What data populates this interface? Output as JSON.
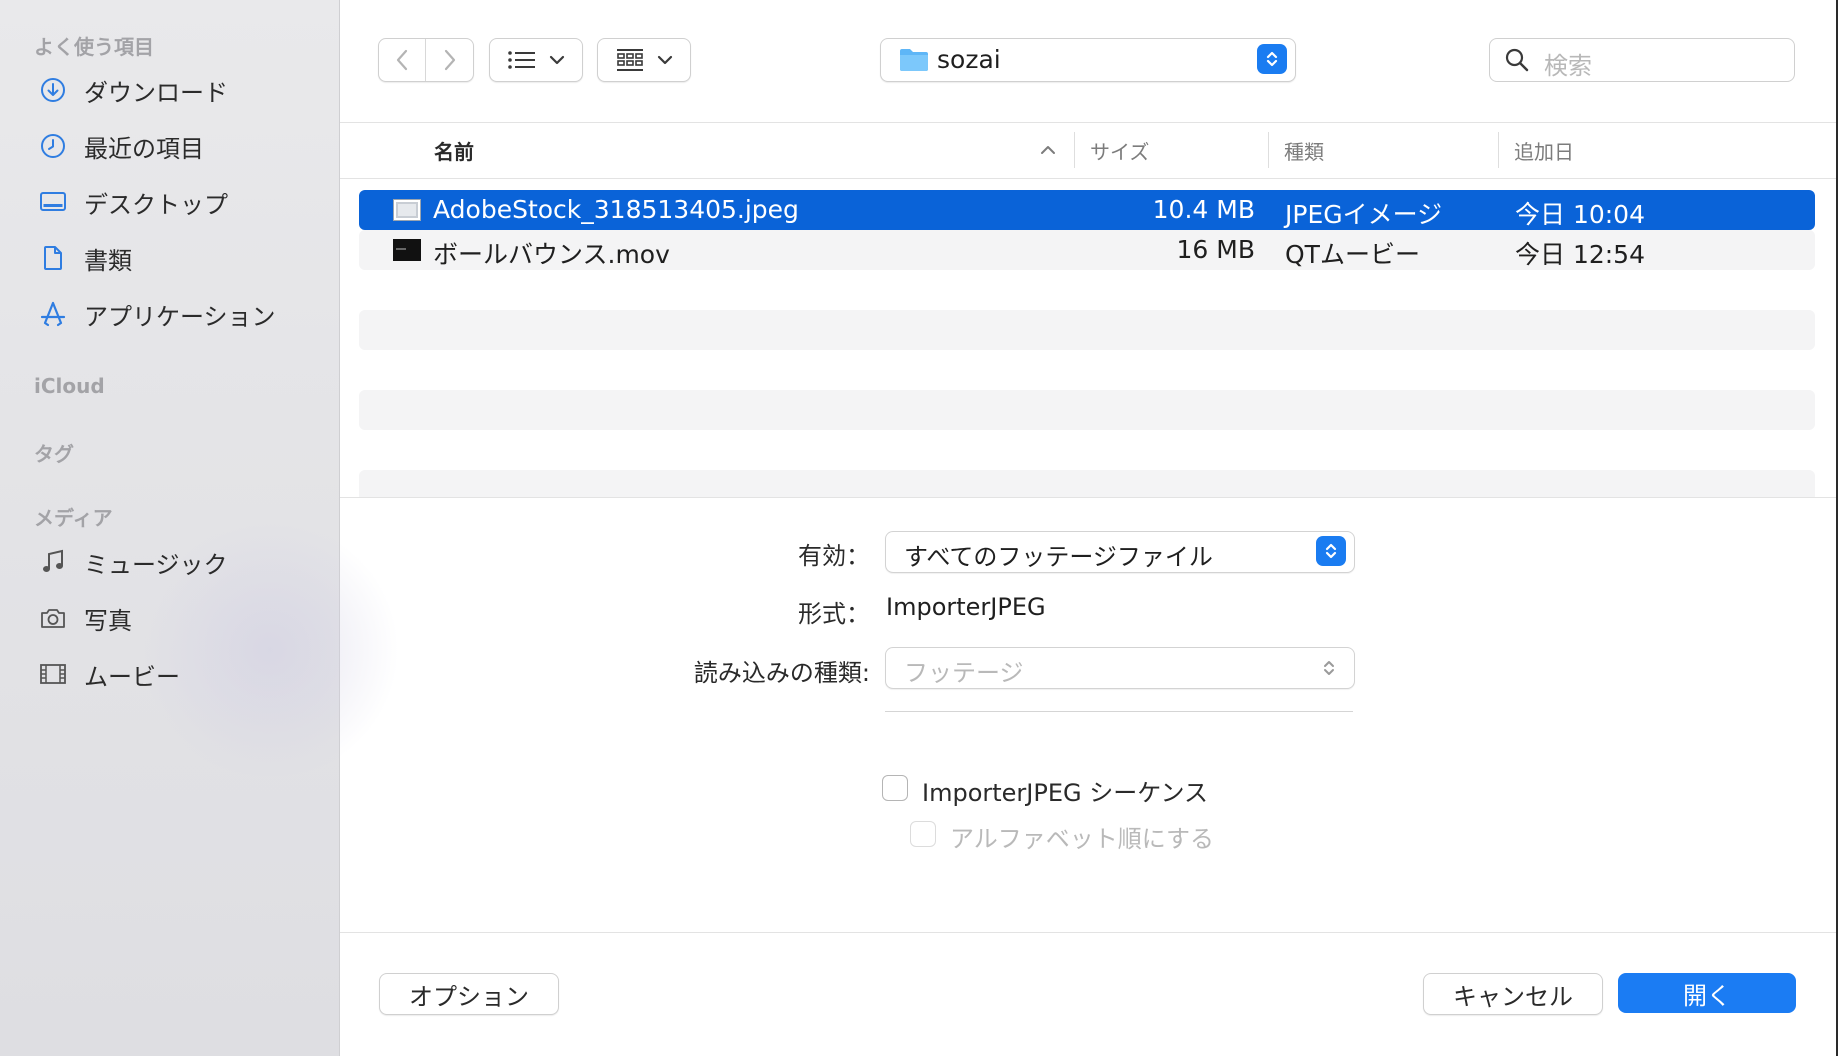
{
  "sidebar": {
    "favorites_header": "よく使う項目",
    "favorites": [
      {
        "label": "ダウンロード",
        "icon": "download-icon"
      },
      {
        "label": "最近の項目",
        "icon": "clock-icon"
      },
      {
        "label": "デスクトップ",
        "icon": "desktop-icon"
      },
      {
        "label": "書類",
        "icon": "document-icon"
      },
      {
        "label": "アプリケーション",
        "icon": "applications-icon"
      }
    ],
    "icloud_header": "iCloud",
    "tags_header": "タグ",
    "media_header": "メディア",
    "media": [
      {
        "label": "ミュージック",
        "icon": "music-note-icon"
      },
      {
        "label": "写真",
        "icon": "camera-icon"
      },
      {
        "label": "ムービー",
        "icon": "film-icon"
      }
    ]
  },
  "toolbar": {
    "current_folder": "sozai",
    "search_placeholder": "検索"
  },
  "list": {
    "columns": {
      "name": "名前",
      "size": "サイズ",
      "kind": "種類",
      "date": "追加日"
    },
    "rows": [
      {
        "name": "AdobeStock_318513405.jpeg",
        "size": "10.4 MB",
        "kind": "JPEGイメージ",
        "date": "今日 10:04",
        "selected": true
      },
      {
        "name": "ボールバウンス.mov",
        "size": "16 MB",
        "kind": "QTムービー",
        "date": "今日 12:54",
        "selected": false
      }
    ]
  },
  "options": {
    "enable_label": "有効：",
    "enable_value": "すべてのフッテージファイル",
    "format_label": "形式：",
    "format_value": "ImporterJPEG",
    "import_kind_label": "読み込みの種類:",
    "import_kind_value": "フッテージ",
    "sequence_label": "ImporterJPEG シーケンス",
    "alpha_label": "アルファベット順にする"
  },
  "footer": {
    "options_button": "オプション",
    "cancel_button": "キャンセル",
    "open_button": "開く"
  },
  "colors": {
    "accent": "#1b7cf3",
    "selection": "#0a63d8",
    "sidebar_icon": "#2f7de1"
  }
}
